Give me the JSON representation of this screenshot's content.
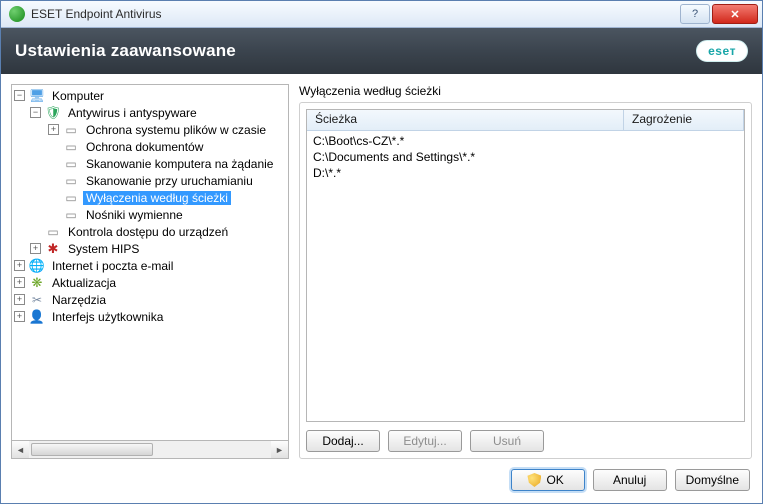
{
  "window": {
    "title": "ESET Endpoint Antivirus",
    "help_tip": "?",
    "close_glyph": "✕"
  },
  "header": {
    "title": "Ustawienia zaawansowane",
    "logo_text": "eseт"
  },
  "tree": {
    "root": "Komputer",
    "av": "Antywirus i antyspyware",
    "realtime": "Ochrona systemu plików w czasie",
    "docs": "Ochrona dokumentów",
    "ondemand": "Skanowanie komputera na żądanie",
    "startup": "Skanowanie przy uruchamianiu",
    "excl": "Wyłączenia według ścieżki",
    "removable": "Nośniki wymienne",
    "devctl": "Kontrola dostępu do urządzeń",
    "hips": "System HIPS",
    "internet": "Internet i poczta e-mail",
    "update": "Aktualizacja",
    "tools": "Narzędzia",
    "ui": "Interfejs użytkownika"
  },
  "section": {
    "title": "Wyłączenia według ścieżki",
    "col_path": "Ścieżka",
    "col_threat": "Zagrożenie",
    "rows": [
      "C:\\Boot\\cs-CZ\\*.*",
      "C:\\Documents and Settings\\*.*",
      "D:\\*.*"
    ]
  },
  "buttons": {
    "add": "Dodaj...",
    "edit": "Edytuj...",
    "remove": "Usuń",
    "ok": "OK",
    "cancel": "Anuluj",
    "default": "Domyślne"
  }
}
